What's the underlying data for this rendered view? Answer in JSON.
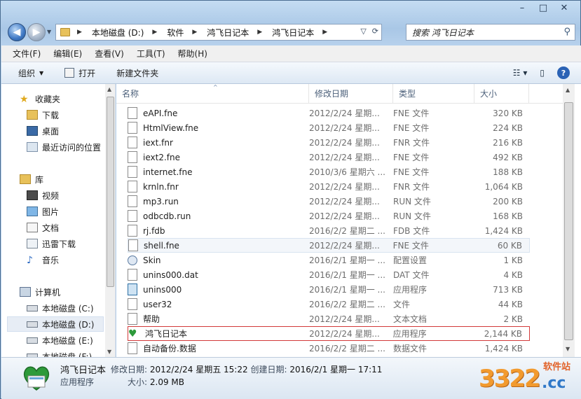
{
  "caption": {
    "minimize": "–",
    "maximize": "□",
    "close": "✕"
  },
  "address": {
    "crumbs": [
      "本地磁盘 (D:)",
      "软件",
      "鸿飞日记本",
      "鸿飞日记本"
    ]
  },
  "search": {
    "placeholder": "搜索 鸿飞日记本"
  },
  "menu": [
    "文件(F)",
    "编辑(E)",
    "查看(V)",
    "工具(T)",
    "帮助(H)"
  ],
  "toolbar": {
    "organize": "组织",
    "open": "打开",
    "new_folder": "新建文件夹"
  },
  "nav": {
    "favorites": "收藏夹",
    "downloads": "下载",
    "desktop": "桌面",
    "recent": "最近访问的位置",
    "libraries": "库",
    "videos": "视频",
    "pictures": "图片",
    "documents": "文档",
    "thunder": "迅雷下载",
    "music": "音乐",
    "computer": "计算机",
    "drive_c": "本地磁盘 (C:)",
    "drive_d": "本地磁盘 (D:)",
    "drive_e": "本地磁盘 (E:)",
    "drive_f": "本地磁盘 (F:)"
  },
  "columns": {
    "name": "名称",
    "date": "修改日期",
    "type": "类型",
    "size": "大小"
  },
  "files": [
    {
      "name": "eAPI.fne",
      "date": "2012/2/24 星期...",
      "type": "FNE 文件",
      "size": "320 KB",
      "icon": "file-icon"
    },
    {
      "name": "HtmlView.fne",
      "date": "2012/2/24 星期...",
      "type": "FNE 文件",
      "size": "224 KB",
      "icon": "file-icon"
    },
    {
      "name": "iext.fnr",
      "date": "2012/2/24 星期...",
      "type": "FNR 文件",
      "size": "216 KB",
      "icon": "file-icon"
    },
    {
      "name": "iext2.fne",
      "date": "2012/2/24 星期...",
      "type": "FNE 文件",
      "size": "492 KB",
      "icon": "file-icon"
    },
    {
      "name": "internet.fne",
      "date": "2010/3/6 星期六 ...",
      "type": "FNE 文件",
      "size": "188 KB",
      "icon": "file-icon"
    },
    {
      "name": "krnln.fnr",
      "date": "2012/2/24 星期...",
      "type": "FNR 文件",
      "size": "1,064 KB",
      "icon": "file-icon"
    },
    {
      "name": "mp3.run",
      "date": "2012/2/24 星期...",
      "type": "RUN 文件",
      "size": "200 KB",
      "icon": "file-icon"
    },
    {
      "name": "odbcdb.run",
      "date": "2012/2/24 星期...",
      "type": "RUN 文件",
      "size": "168 KB",
      "icon": "file-icon"
    },
    {
      "name": "rj.fdb",
      "date": "2016/2/2 星期二 ...",
      "type": "FDB 文件",
      "size": "1,424 KB",
      "icon": "file-icon"
    },
    {
      "name": "shell.fne",
      "date": "2012/2/24 星期...",
      "type": "FNE 文件",
      "size": "60 KB",
      "icon": "file-icon"
    },
    {
      "name": "Skin",
      "date": "2016/2/1 星期一 ...",
      "type": "配置设置",
      "size": "1 KB",
      "icon": "config-icon"
    },
    {
      "name": "unins000.dat",
      "date": "2016/2/1 星期一 ...",
      "type": "DAT 文件",
      "size": "4 KB",
      "icon": "file-icon"
    },
    {
      "name": "unins000",
      "date": "2016/2/1 星期一 ...",
      "type": "应用程序",
      "size": "713 KB",
      "icon": "app-icon"
    },
    {
      "name": "user32",
      "date": "2016/2/2 星期二 ...",
      "type": "文件",
      "size": "44 KB",
      "icon": "file-icon"
    },
    {
      "name": "帮助",
      "date": "2012/2/24 星期...",
      "type": "文本文档",
      "size": "2 KB",
      "icon": "file-icon"
    },
    {
      "name": "鸿飞日记本",
      "date": "2012/2/24 星期...",
      "type": "应用程序",
      "size": "2,144 KB",
      "icon": "heart-app-icon"
    },
    {
      "name": "自动备份.数据",
      "date": "2016/2/2 星期二 ...",
      "type": "数据文件",
      "size": "1,424 KB",
      "icon": "file-icon"
    }
  ],
  "details": {
    "name": "鸿飞日记本",
    "modified_label": "修改日期:",
    "modified": "2012/2/24 星期五 15:22",
    "created_label": "创建日期:",
    "created": "2016/2/1 星期一 17:11",
    "type": "应用程序",
    "size_label": "大小:",
    "size": "2.09 MB"
  },
  "watermark": {
    "number": "3322",
    "cc": ".cc",
    "site": "软件站"
  },
  "colors": {
    "highlight_border": "#d23a3a",
    "accent": "#2a62b5"
  }
}
